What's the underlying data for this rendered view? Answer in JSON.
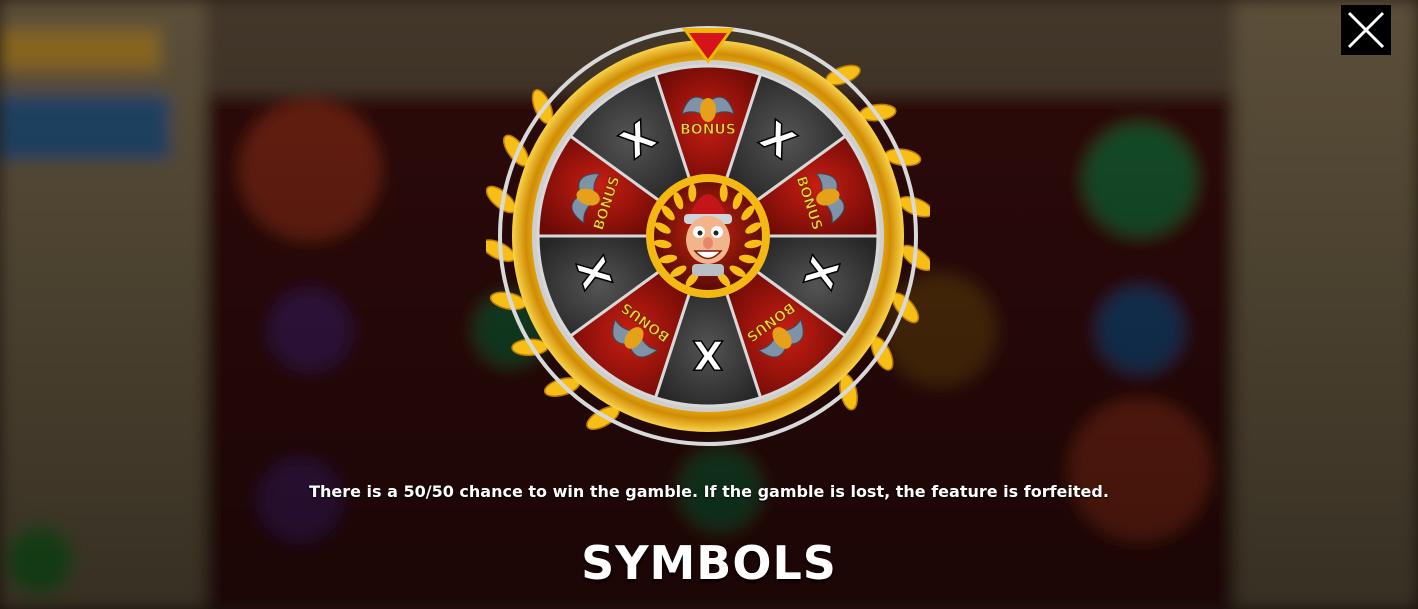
{
  "wheel": {
    "center_symbol": "centurion-character",
    "pointer_icon": "red-triangle-pointer",
    "segments": [
      {
        "type": "bonus",
        "label": "BONUS"
      },
      {
        "type": "lose",
        "label": "X"
      },
      {
        "type": "bonus",
        "label": "BONUS"
      },
      {
        "type": "lose",
        "label": "X"
      },
      {
        "type": "bonus",
        "label": "BONUS"
      },
      {
        "type": "lose",
        "label": "X"
      },
      {
        "type": "bonus",
        "label": "BONUS"
      },
      {
        "type": "lose",
        "label": "X"
      },
      {
        "type": "bonus",
        "label": "BONUS"
      },
      {
        "type": "lose",
        "label": "X"
      }
    ]
  },
  "info": {
    "text": "There is a 50/50 chance to win the gamble. If the gamble is lost, the feature is forfeited."
  },
  "section": {
    "title": "SYMBOLS"
  },
  "close": {
    "icon": "close-icon"
  },
  "colors": {
    "bonus_segment": "#a8160f",
    "lose_segment": "#3a3a3a",
    "gold": "#f2b705",
    "pointer": "#d4141a",
    "close_bg": "#000000"
  }
}
